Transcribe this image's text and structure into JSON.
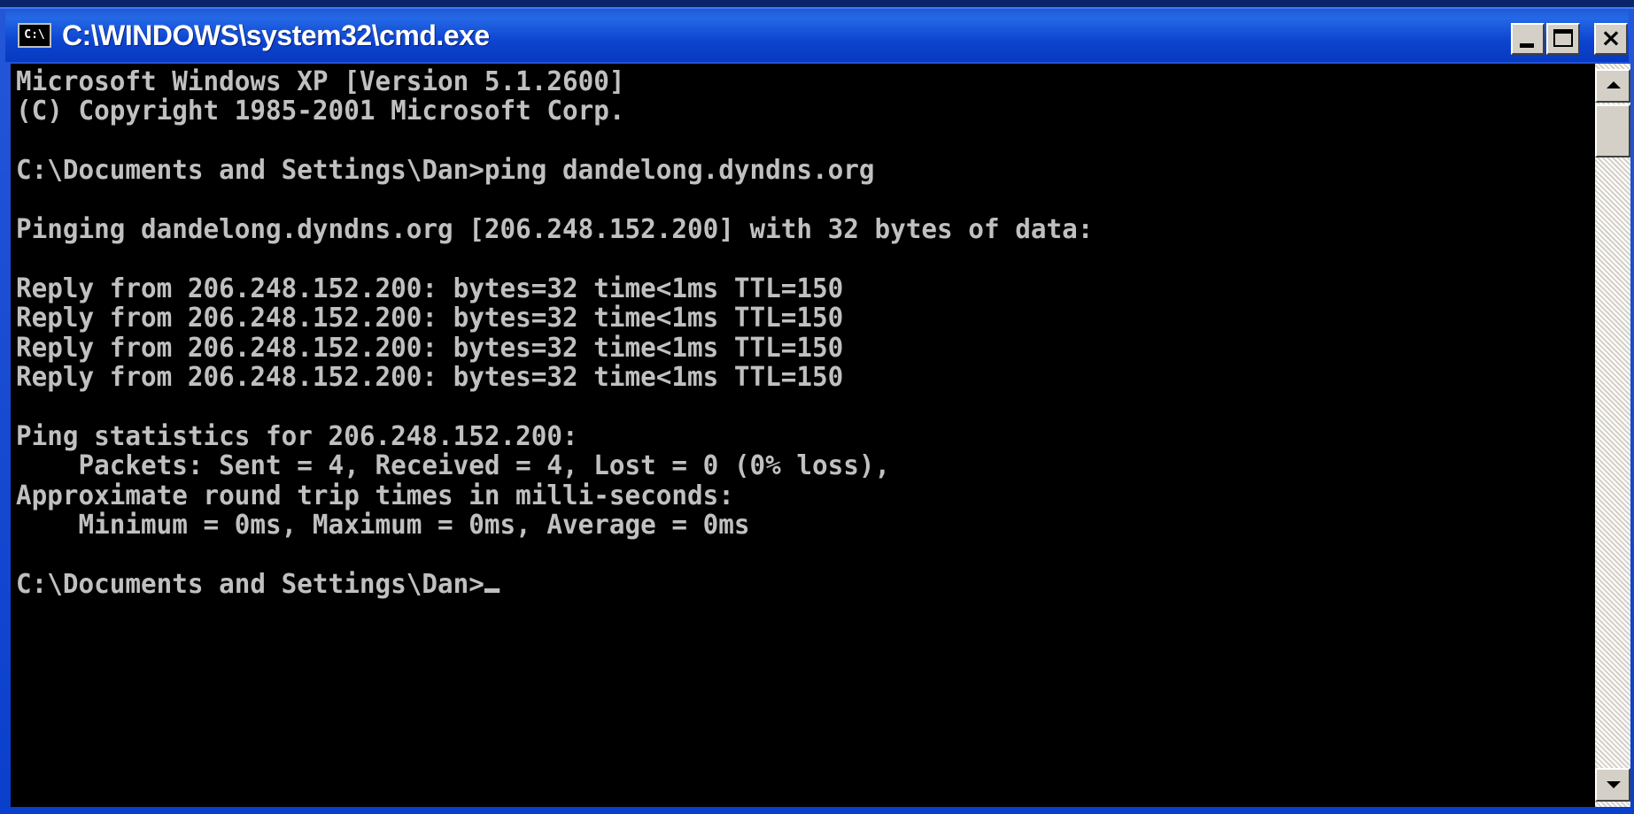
{
  "window": {
    "title": "C:\\WINDOWS\\system32\\cmd.exe",
    "icon_label": "C:\\",
    "controls": {
      "minimize": "minimize-icon",
      "maximize": "maximize-icon",
      "close": "×"
    }
  },
  "console": {
    "lines": [
      "Microsoft Windows XP [Version 5.1.2600]",
      "(C) Copyright 1985-2001 Microsoft Corp.",
      "",
      "C:\\Documents and Settings\\Dan>ping dandelong.dyndns.org",
      "",
      "Pinging dandelong.dyndns.org [206.248.152.200] with 32 bytes of data:",
      "",
      "Reply from 206.248.152.200: bytes=32 time<1ms TTL=150",
      "Reply from 206.248.152.200: bytes=32 time<1ms TTL=150",
      "Reply from 206.248.152.200: bytes=32 time<1ms TTL=150",
      "Reply from 206.248.152.200: bytes=32 time<1ms TTL=150",
      "",
      "Ping statistics for 206.248.152.200:",
      "    Packets: Sent = 4, Received = 4, Lost = 0 (0% loss),",
      "Approximate round trip times in milli-seconds:",
      "    Minimum = 0ms, Maximum = 0ms, Average = 0ms",
      ""
    ],
    "prompt": "C:\\Documents and Settings\\Dan>"
  },
  "colors": {
    "console_background": "#000000",
    "console_text": "#c0c0c0",
    "titlebar": "#0839c0"
  }
}
